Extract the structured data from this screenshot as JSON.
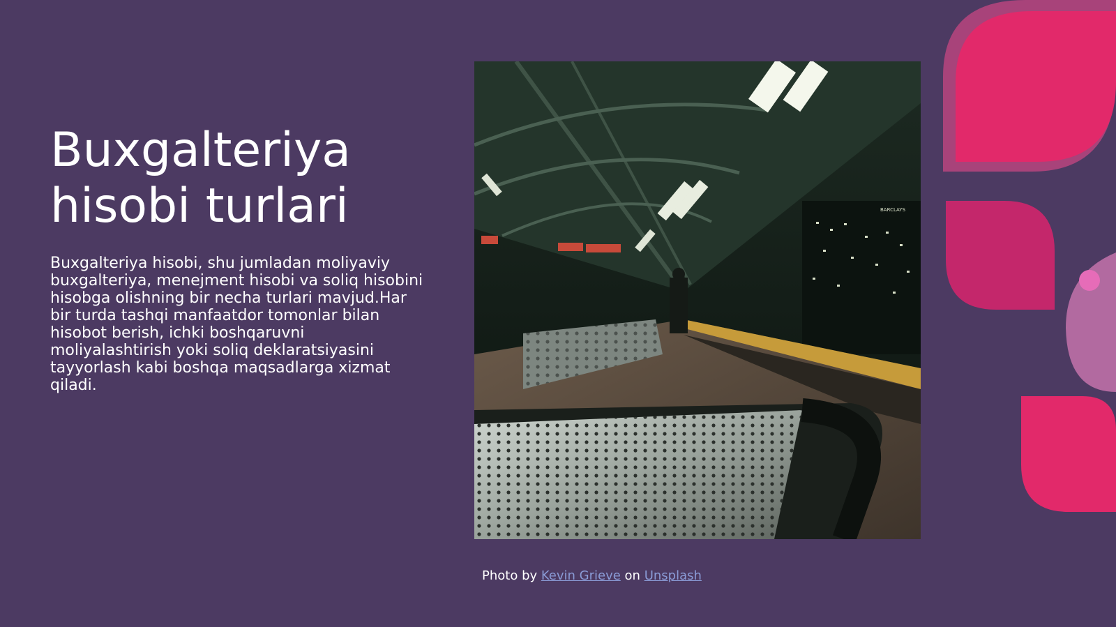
{
  "slide": {
    "title": "Buxgalteriya hisobi turlari",
    "body": "Buxgalteriya hisobi, shu jumladan moliyaviy buxgalteriya, menejment hisobi va soliq hisobini hisobga olishning bir necha turlari mavjud.Har bir turda tashqi manfaatdor tomonlar bilan hisobot berish, ichki boshqaruvni moliyalashtirish yoki soliq deklaratsiyasini tayyorlash kabi boshqa maqsadlarga xizmat qiladi."
  },
  "photo": {
    "credit_prefix": "Photo by",
    "author": "Kevin Grieve",
    "credit_middle": "on",
    "source": "Unsplash",
    "sign_text": "BARCLAYS"
  },
  "colors": {
    "background": "#4c3a62",
    "accent_pink": "#e2296a",
    "accent_rose": "#c4276b",
    "accent_mauve": "#b26aa0",
    "link": "#8a9bd6"
  }
}
